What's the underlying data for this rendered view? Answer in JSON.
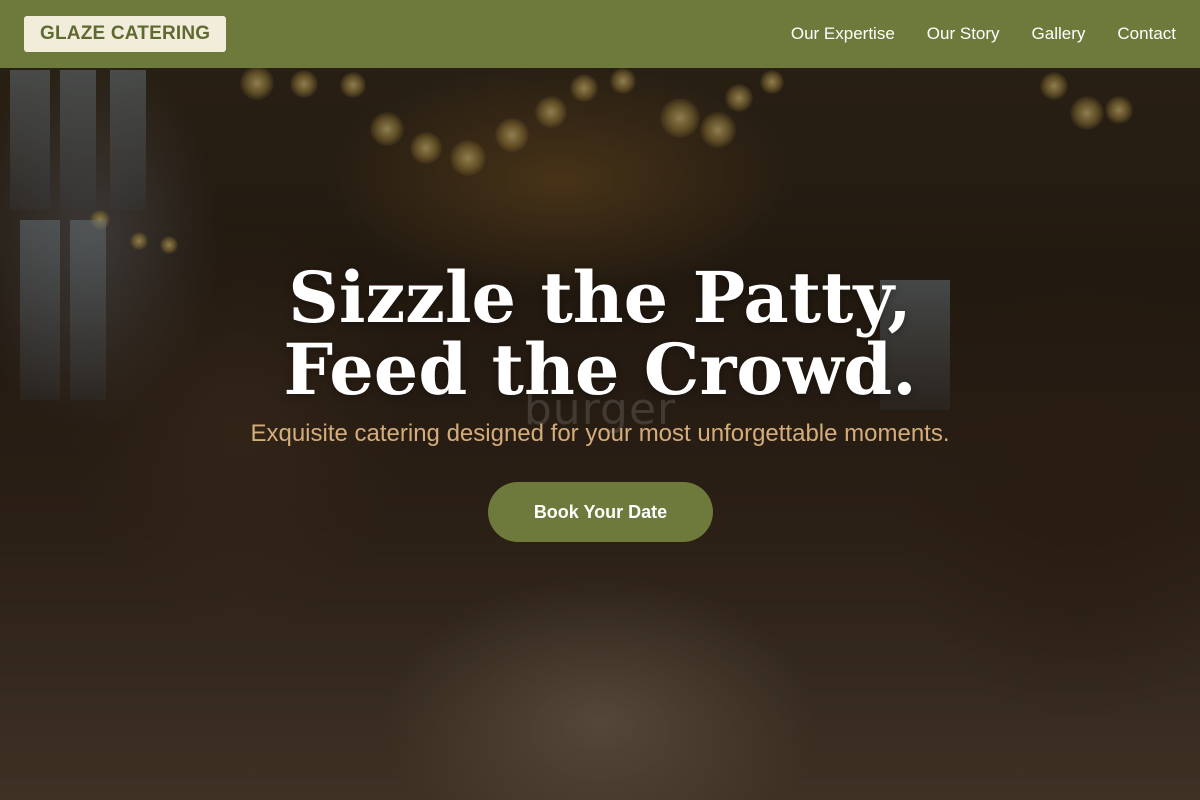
{
  "brand": {
    "logo_text": "GLAZE CATERING",
    "accent_color": "#6d7a3c",
    "logo_bg": "#f2eddb"
  },
  "nav": {
    "items": [
      {
        "label": "Our Expertise"
      },
      {
        "label": "Our Story"
      },
      {
        "label": "Gallery"
      },
      {
        "label": "Contact"
      }
    ]
  },
  "hero": {
    "title_line1": "Sizzle the Patty,",
    "title_line2": "Feed the Crowd.",
    "subtitle": "Exquisite catering designed for your most unforgettable moments.",
    "watermark": "burger",
    "cta_label": "Book Your Date",
    "image_description_icon": "celebration-photo"
  }
}
